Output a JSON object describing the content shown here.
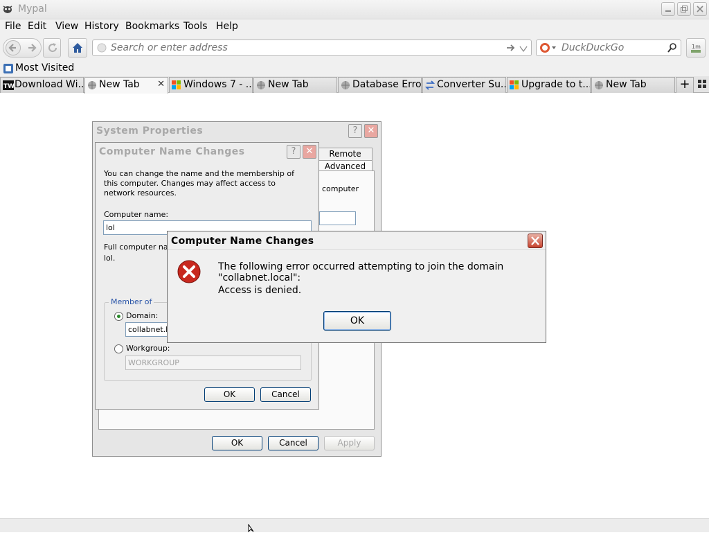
{
  "window": {
    "title": "Mypal"
  },
  "menu": [
    "File",
    "Edit",
    "View",
    "History",
    "Bookmarks",
    "Tools",
    "Help"
  ],
  "nav": {
    "address_placeholder": "Search or enter address",
    "search_placeholder": "DuckDuckGo"
  },
  "bookmarks": {
    "most_visited": "Most Visited"
  },
  "tabs": [
    {
      "label": "Download Wi...",
      "icon": "tw-logo-icon",
      "active": false
    },
    {
      "label": "New Tab",
      "icon": "globe-icon",
      "active": true
    },
    {
      "label": "Windows 7 - ...",
      "icon": "windows-logo-icon",
      "active": false
    },
    {
      "label": "New Tab",
      "icon": "globe-icon",
      "active": false
    },
    {
      "label": "Database Error",
      "icon": "globe-icon",
      "active": false
    },
    {
      "label": "Converter Su...",
      "icon": "converter-icon",
      "active": false
    },
    {
      "label": "Upgrade to t...",
      "icon": "windows-logo-icon",
      "active": false
    },
    {
      "label": "New Tab",
      "icon": "globe-icon",
      "active": false
    }
  ],
  "system_properties": {
    "title": "System Properties",
    "tabs": [
      "Remote",
      "Advanced"
    ],
    "partial_text": "computer",
    "buttons": {
      "ok": "OK",
      "cancel": "Cancel",
      "apply": "Apply"
    }
  },
  "computer_name_changes": {
    "title": "Computer Name Changes",
    "intro": "You can change the name and the membership of this computer. Changes may affect access to network resources.",
    "computer_name_label": "Computer name:",
    "computer_name_value": "lol",
    "full_name_label": "Full computer name:",
    "full_name_value": "lol.",
    "member_of": "Member of",
    "domain_label": "Domain:",
    "domain_value": "collabnet.local",
    "workgroup_label": "Workgroup:",
    "workgroup_value": "WORKGROUP",
    "domain_selected": true,
    "buttons": {
      "ok": "OK",
      "cancel": "Cancel"
    }
  },
  "error_dialog": {
    "title": "Computer Name Changes",
    "message": "The following error occurred attempting to join the domain \"collabnet.local\":",
    "detail": "Access is denied.",
    "ok": "OK",
    "icon": "error-x-icon"
  }
}
